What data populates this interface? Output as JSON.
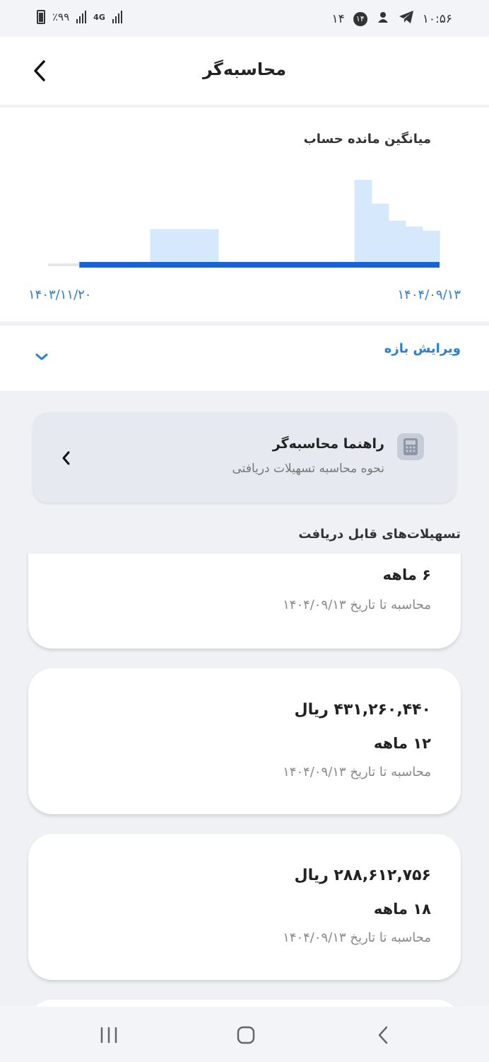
{
  "status_bar": {
    "battery_text": "٪۹۹",
    "network": "4G",
    "notification_count": "۱۴",
    "badge_number": "۱۴",
    "time": "۱۰:۵۶"
  },
  "header": {
    "title": "محاسبه‌گر",
    "back_icon": "chevron-left-icon"
  },
  "chart_card": {
    "title": "میانگین مانده حساب",
    "start_date": "۱۴۰۳/۱۱/۲۰",
    "end_date": "۱۴۰۴/۰۹/۱۳"
  },
  "chart_data": {
    "type": "area",
    "title": "میانگین مانده حساب",
    "x_start": "۱۴۰۳/۱۱/۲۰",
    "x_end": "۱۴۰۴/۰۹/۱۳",
    "series": [
      {
        "values": [
          0,
          0,
          0,
          0,
          0,
          0,
          0.42,
          0.42,
          0.42,
          0.42,
          0,
          0,
          0,
          0,
          0,
          0,
          0,
          0,
          1.0,
          0.72,
          0.52,
          0.45,
          0.4
        ]
      }
    ],
    "selected_range_fraction": [
      0.08,
      1.0
    ],
    "colors": {
      "area": "#d6e8fb",
      "range_bar": "#1565d8",
      "unselected": "#e6e6e6"
    }
  },
  "range": {
    "label": "ویرایش بازه",
    "icon": "chevron-down-icon"
  },
  "guide": {
    "title": "راهنما محاسبه‌گر",
    "subtitle": "نحوه محاسبه تسهیلات دریافتی",
    "icon": "calculator-icon",
    "chevron_icon": "chevron-left-icon"
  },
  "section": {
    "title": "تسهیلات‌های قابل دریافت"
  },
  "loans": [
    {
      "amount": "",
      "term": "۶ ماهه",
      "date": "محاسبه تا تاریخ ۱۴۰۴/۰۹/۱۳"
    },
    {
      "amount": "۴۳۱,۲۶۰,۴۴۰ ریال",
      "term": "۱۲ ماهه",
      "date": "محاسبه تا تاریخ ۱۴۰۴/۰۹/۱۳"
    },
    {
      "amount": "۲۸۸,۶۱۲,۷۵۶ ریال",
      "term": "۱۸ ماهه",
      "date": "محاسبه تا تاریخ ۱۴۰۴/۰۹/۱۳"
    }
  ],
  "nav": {
    "recent_icon": "recent-apps-icon",
    "home_icon": "home-icon",
    "back_icon": "back-icon"
  }
}
